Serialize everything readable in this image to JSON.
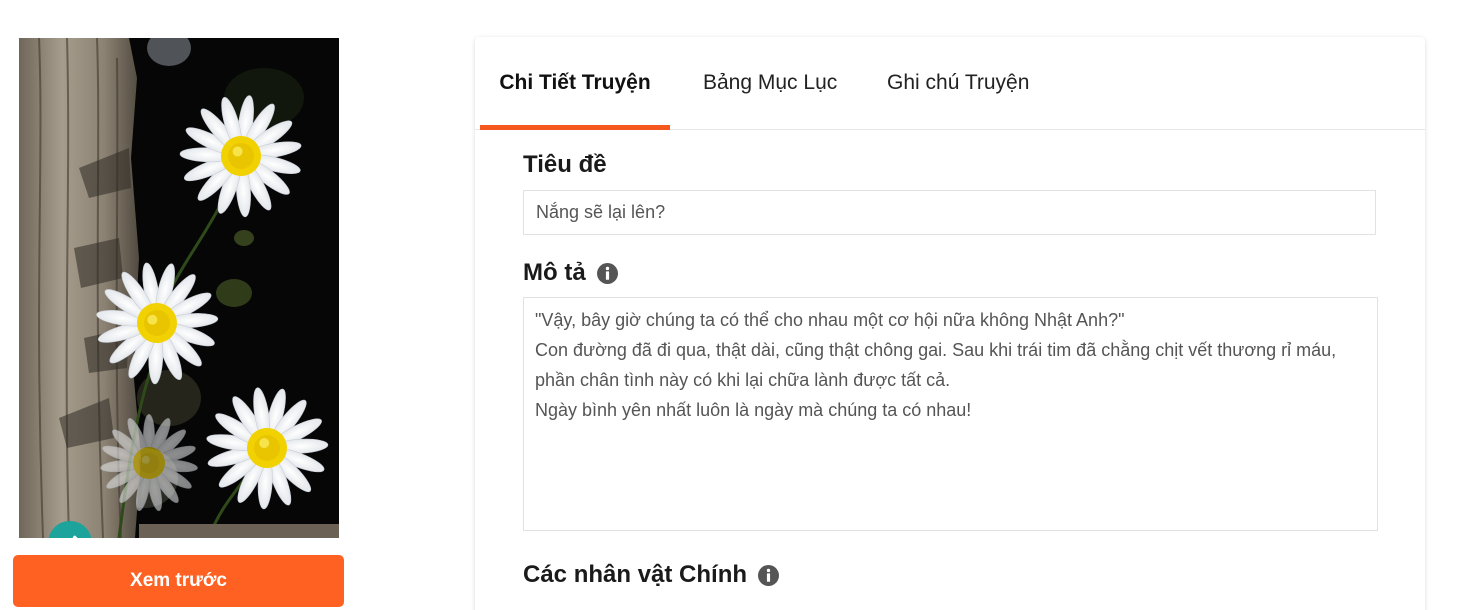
{
  "cover": {
    "edit_icon": "pencil-icon",
    "preview_label": "Xem trước",
    "colors": {
      "preview_button": "#ff6122",
      "edit_button": "#1ba39c"
    }
  },
  "tabs": [
    {
      "label": "Chi Tiết Truyện",
      "active": true
    },
    {
      "label": "Bảng Mục Lục",
      "active": false
    },
    {
      "label": "Ghi chú Truyện",
      "active": false
    }
  ],
  "accent_color": "#f4581f",
  "form": {
    "title": {
      "label": "Tiêu đề",
      "value": "Nắng sẽ lại lên?"
    },
    "description": {
      "label": "Mô tả",
      "info_icon": "info-icon",
      "lines": [
        "\"Vậy, bây giờ chúng ta có thể cho nhau một cơ hội nữa không Nhật Anh?\"",
        "Con đường đã đi qua, thật dài, cũng thật chông gai. Sau khi trái tim đã chằng chịt vết thương rỉ máu,",
        "phần chân tình này có khi lại chữa lành được tất cả.",
        "Ngày bình yên nhất luôn là ngày mà chúng ta có nhau!"
      ]
    },
    "main_characters": {
      "label": "Các nhân vật Chính",
      "info_icon": "info-icon"
    }
  }
}
